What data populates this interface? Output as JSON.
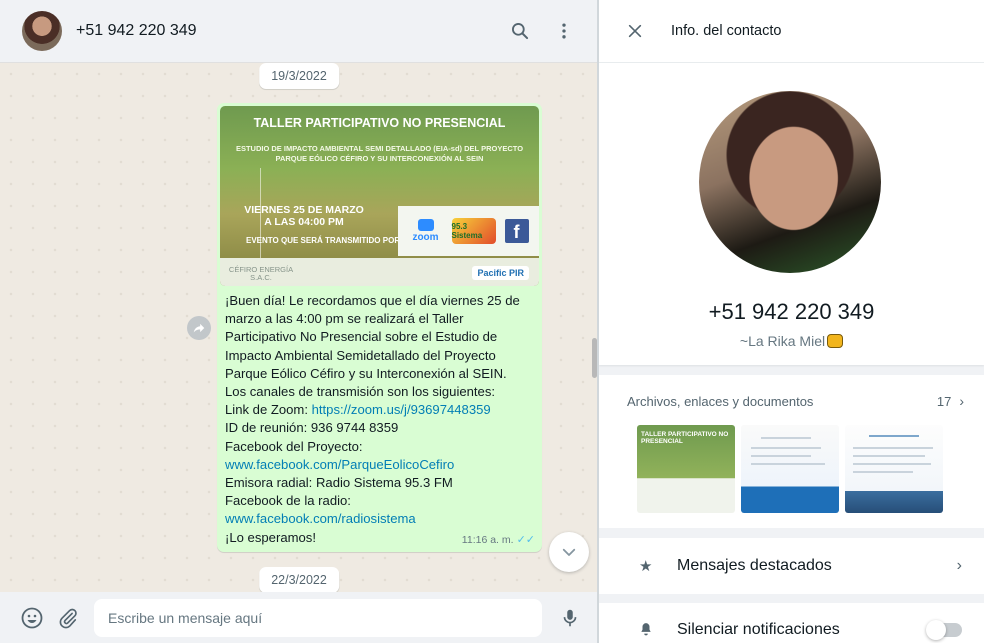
{
  "chat": {
    "header": {
      "contact_name": "+51 942 220 349",
      "search_icon": "search-icon",
      "menu_icon": "more-vertical-icon"
    },
    "dates": [
      "19/3/2022",
      "22/3/2022"
    ],
    "message": {
      "poster": {
        "title": "TALLER PARTICIPATIVO NO PRESENCIAL",
        "subtitle": "ESTUDIO DE IMPACTO AMBIENTAL SEMI DETALLADO (EIA-sd) DEL PROYECTO PARQUE EÓLICO CÉFIRO Y SU INTERCONEXIÓN AL SEIN",
        "date": "VIERNES 25 DE MARZO A LAS 04:00 PM",
        "event_line": "EVENTO QUE SERÁ TRANSMITIDO POR:",
        "zoom_label": "zoom",
        "radio_label": "95.3 Sistema",
        "facebook_label": "f",
        "company": "CÉFIRO ENERGÍA S.A.C.",
        "partner": "Pacific PIR"
      },
      "text_parts": [
        "¡Buen día! Le recordamos que el día viernes 25 de marzo a las 4:00 pm se realizará el Taller Participativo No Presencial sobre el Estudio de Impacto Ambiental Semidetallado del Proyecto Parque Eólico Céfiro y su Interconexión al SEIN.\nLos canales de transmisión son los siguientes:\nLink de Zoom: ",
        "https://zoom.us/j/93697448359",
        "\nID de reunión: 936 9744 8359\nFacebook del Proyecto:\n",
        "www.facebook.com/ParqueEolicoCefiro",
        "\nEmisora radial: Radio Sistema 95.3 FM\nFacebook de la radio:\n",
        "www.facebook.com/radiosistema",
        "\n¡Lo esperamos!"
      ],
      "time": "11:16 a. m.",
      "status": "read"
    },
    "composer": {
      "placeholder": "Escribe un mensaje aquí",
      "emoji_icon": "emoji-icon",
      "attach_icon": "paperclip-icon",
      "mic_icon": "microphone-icon"
    }
  },
  "info": {
    "title": "Info. del contacto",
    "phone": "+51 942 220 349",
    "about": "~La Rika Miel",
    "media": {
      "label": "Archivos, enlaces y documentos",
      "count": "17",
      "thumb1_text": "TALLER PARTICIPATIVO NO PRESENCIAL"
    },
    "starred_label": "Mensajes destacados",
    "mute_label": "Silenciar notificaciones",
    "mute_enabled": false
  },
  "colors": {
    "bubble_out": "#d9fdd3",
    "link": "#027eb5",
    "read_ticks": "#53bdeb",
    "panel_bg": "#f0f2f5"
  }
}
